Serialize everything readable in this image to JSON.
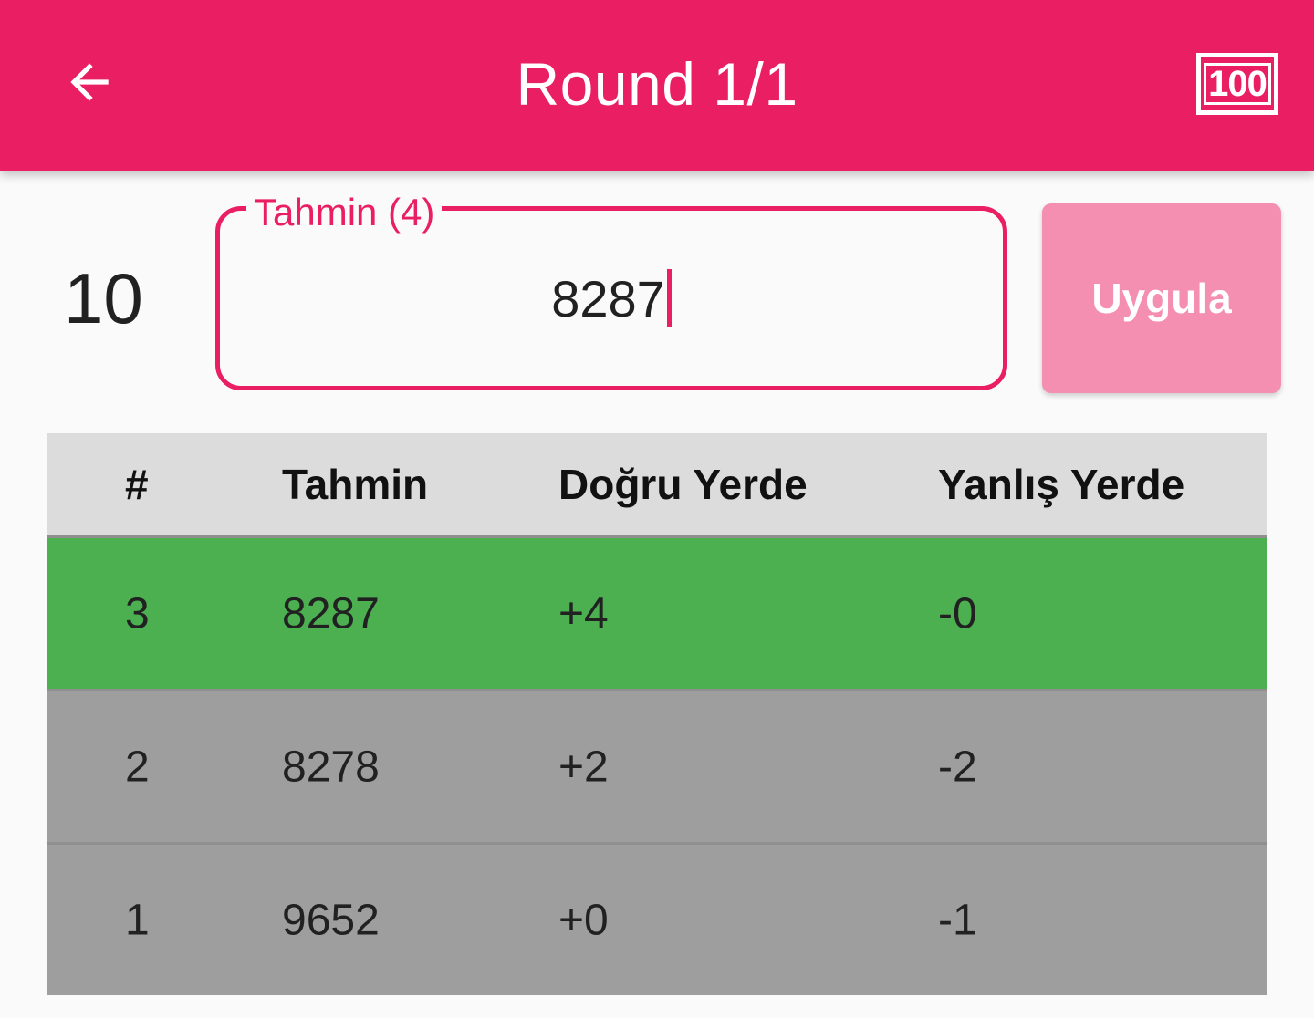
{
  "app_bar": {
    "title": "Round 1/1",
    "score_icon_text": "100",
    "back_icon": "arrow-left-icon",
    "score_icon": "score-100-icon",
    "color": "#e91e63"
  },
  "remaining": "10",
  "guess_input": {
    "label": "Tahmin (4)",
    "value": "8287"
  },
  "apply_button": {
    "label": "Uygula",
    "color": "#f48fb1"
  },
  "table": {
    "headers": [
      "#",
      "Tahmin",
      "Doğru Yerde",
      "Yanlış Yerde"
    ],
    "rows": [
      {
        "no": "3",
        "guess": "8287",
        "correct": "+4",
        "misplaced": "-0",
        "status": "win"
      },
      {
        "no": "2",
        "guess": "8278",
        "correct": "+2",
        "misplaced": "-2",
        "status": "miss"
      },
      {
        "no": "1",
        "guess": "9652",
        "correct": "+0",
        "misplaced": "-1",
        "status": "miss"
      }
    ],
    "win_color": "#4caf50",
    "miss_color": "#9e9e9e",
    "header_color": "#dcdcdc"
  }
}
